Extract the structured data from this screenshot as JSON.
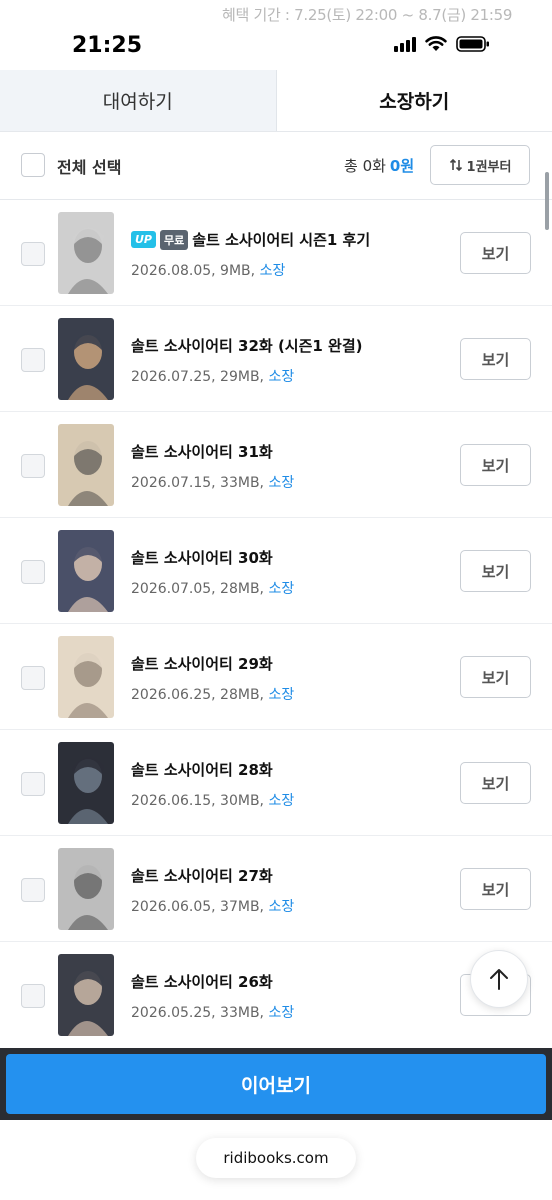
{
  "status": {
    "promo": "혜택 기간 : 7.25(토) 22:00 ~ 8.7(금) 21:59",
    "time": "21:25"
  },
  "tabs": [
    {
      "label": "대여하기",
      "active": false
    },
    {
      "label": "소장하기",
      "active": true
    }
  ],
  "select_bar": {
    "select_all": "전체 선택",
    "total_count": "총 0화",
    "total_price": "0원",
    "sort": "1권부터"
  },
  "episodes": [
    {
      "badges": [
        "UP",
        "무료"
      ],
      "title": "솔트 소사이어티 시즌1 후기",
      "meta": "2026.08.05, 9MB,",
      "own": "소장",
      "button": "보기",
      "colors": [
        "#cfcfcf",
        "#8a8a8a"
      ]
    },
    {
      "badges": [],
      "title": "솔트 소사이어티 32화 (시즌1 완결)",
      "meta": "2026.07.25, 29MB,",
      "own": "소장",
      "button": "보기",
      "colors": [
        "#3a3f4c",
        "#c9a27c"
      ]
    },
    {
      "badges": [],
      "title": "솔트 소사이어티 31화",
      "meta": "2026.07.15, 33MB,",
      "own": "소장",
      "button": "보기",
      "colors": [
        "#d7c9b2",
        "#6f6a63"
      ]
    },
    {
      "badges": [],
      "title": "솔트 소사이어티 30화",
      "meta": "2026.07.05, 28MB,",
      "own": "소장",
      "button": "보기",
      "colors": [
        "#4a5068",
        "#d8c2b2"
      ]
    },
    {
      "badges": [],
      "title": "솔트 소사이어티 29화",
      "meta": "2026.06.25, 28MB,",
      "own": "소장",
      "button": "보기",
      "colors": [
        "#e4d8c6",
        "#9c8f80"
      ]
    },
    {
      "badges": [],
      "title": "솔트 소사이어티 28화",
      "meta": "2026.06.15, 30MB,",
      "own": "소장",
      "button": "보기",
      "colors": [
        "#2c2f38",
        "#6e7a8a"
      ]
    },
    {
      "badges": [],
      "title": "솔트 소사이어티 27화",
      "meta": "2026.06.05, 37MB,",
      "own": "소장",
      "button": "보기",
      "colors": [
        "#bdbdbd",
        "#6a6a6a"
      ]
    },
    {
      "badges": [],
      "title": "솔트 소사이어티 26화",
      "meta": "2026.05.25, 33MB,",
      "own": "소장",
      "button": "보기",
      "colors": [
        "#3b3e48",
        "#cdb8a8"
      ]
    }
  ],
  "bottom": {
    "continue": "이어보기",
    "url": "ridibooks.com"
  },
  "icons": {
    "sort": "sort-arrows-icon",
    "top": "arrow-up-icon"
  },
  "colors": {
    "accent": "#1f8ce6",
    "continue_button": "#2491ef"
  }
}
